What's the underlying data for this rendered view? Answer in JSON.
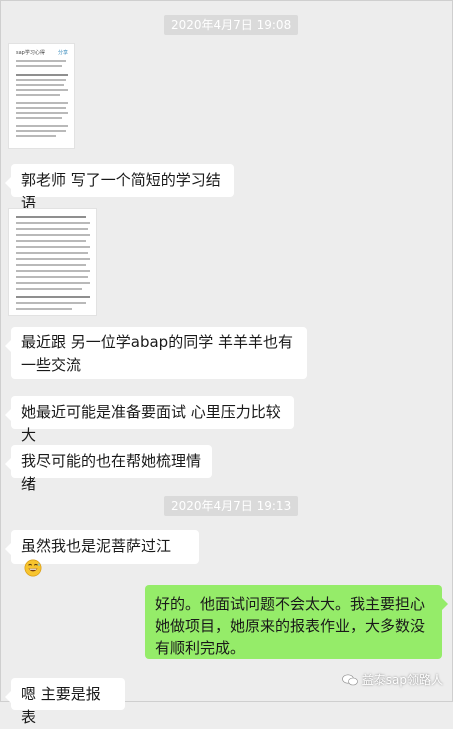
{
  "timestamps": [
    "2020年4月7日 19:08",
    "2020年4月7日 19:13"
  ],
  "doc_image_1": {
    "title": "sap学习心得",
    "badge": "分享"
  },
  "messages": {
    "m1": "郭老师  写了一个简短的学习结语",
    "m2": "最近跟  另一位学abap的同学   羊羊羊也有一些交流",
    "m3": "她最近可能是准备要面试   心里压力比较大",
    "m4": "我尽可能的也在帮她梳理情绪",
    "m5": "虽然我也是泥菩萨过江",
    "m6": "好的。他面试问题不会太大。我主要担心她做项目，她原来的报表作业，大多数没有顺利完成。",
    "m7": "嗯  主要是报表"
  },
  "watermark": "益泰sap领路人",
  "icons": {
    "emoji": "grinning-sweat-emoji",
    "watermark": "wechat-logo-icon"
  }
}
